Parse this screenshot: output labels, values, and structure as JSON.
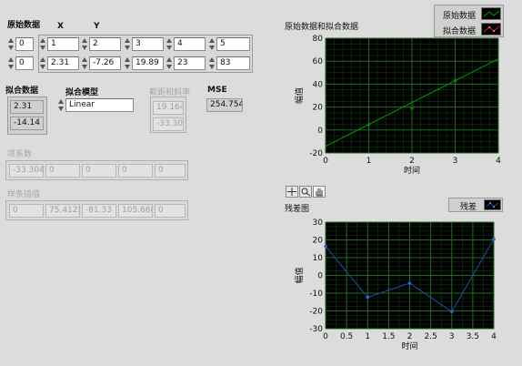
{
  "colors": {
    "fit_line": "#00a000",
    "residual_line": "#1e4ea8",
    "grid": "#1f6b1f",
    "plot_bg": "#000000"
  },
  "original": {
    "label": "原始数据",
    "x_header": "X",
    "y_header": "Y",
    "index_row1": "0",
    "index_row2": "0",
    "x": [
      "1",
      "2",
      "3",
      "4",
      "5"
    ],
    "y": [
      "2.31",
      "-7.26",
      "19.89",
      "23",
      "83"
    ]
  },
  "fit_data": {
    "label": "拟合数据",
    "values": [
      "2.31",
      "-14.14"
    ]
  },
  "model": {
    "label": "拟合模型",
    "selected": "Linear"
  },
  "intercept_slope": {
    "label": "截距和斜率",
    "values": [
      "19.164",
      "-33.304"
    ]
  },
  "mse": {
    "label": "MSE",
    "value": "254.754"
  },
  "coeffs": {
    "label": "项系数",
    "values": [
      "-33.304",
      "0",
      "0",
      "0",
      "0"
    ]
  },
  "spline": {
    "label": "样条插值",
    "values": [
      "0",
      "75.4125",
      "-81.33",
      "105.668",
      "0"
    ]
  },
  "chart_data": [
    {
      "type": "line",
      "title": "原始数据和拟合数据",
      "xlabel": "时间",
      "ylabel": "幅值",
      "xlim": [
        0,
        4
      ],
      "ylim": [
        -20,
        80
      ],
      "xticks": [
        "0",
        "1",
        "2",
        "3",
        "4"
      ],
      "yticks": [
        "80",
        "60",
        "40",
        "20",
        "0",
        "-20"
      ],
      "grid": true,
      "legend": "top-right",
      "series": [
        {
          "name": "原始数据",
          "x": [
            1,
            2,
            3
          ],
          "y": [
            4.6,
            18.8,
            43
          ]
        },
        {
          "name": "拟合数据",
          "x": [
            0,
            4
          ],
          "y": [
            -14.14,
            62
          ]
        }
      ]
    },
    {
      "type": "line",
      "title": "残差图",
      "xlabel": "时间",
      "ylabel": "幅值",
      "xlim": [
        0,
        4
      ],
      "ylim": [
        -30,
        30
      ],
      "xticks": [
        "0",
        "0.5",
        "1",
        "1.5",
        "2",
        "2.5",
        "3",
        "3.5",
        "4"
      ],
      "yticks": [
        "30",
        "20",
        "10",
        "0",
        "-10",
        "-20",
        "-30"
      ],
      "grid": true,
      "legend": "top-right",
      "series": [
        {
          "name": "残差",
          "x": [
            0,
            1,
            2,
            3,
            4
          ],
          "y": [
            16.4,
            -12.3,
            -4.4,
            -20.4,
            20.4
          ]
        }
      ]
    }
  ]
}
